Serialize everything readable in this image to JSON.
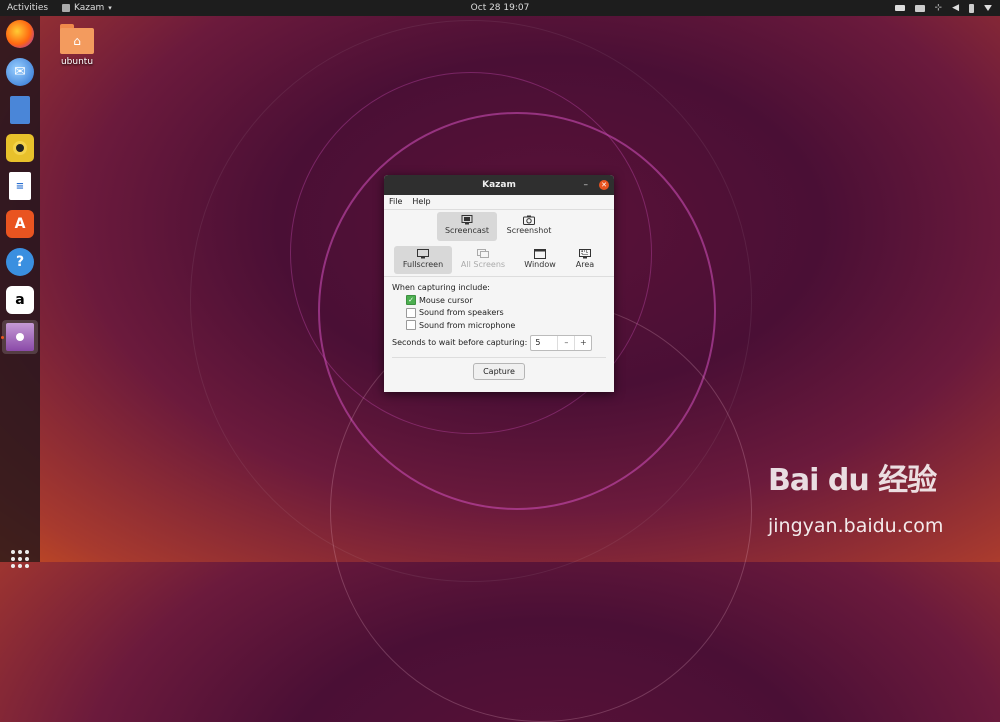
{
  "topbar": {
    "activities": "Activities",
    "app_name": "Kazam",
    "clock": "Oct 28  19:07"
  },
  "dock": {
    "items": [
      "firefox-icon",
      "thunderbird-icon",
      "files-icon",
      "rhythmbox-icon",
      "libreoffice-writer-icon",
      "software-icon",
      "help-icon",
      "amazon-icon",
      "kazam-icon"
    ]
  },
  "desktop": {
    "folder_label": "ubuntu"
  },
  "window": {
    "title": "Kazam",
    "menu": {
      "file": "File",
      "help": "Help"
    },
    "modes": {
      "screencast": "Screencast",
      "screenshot": "Screenshot"
    },
    "targets": {
      "fullscreen": "Fullscreen",
      "all_screens": "All Screens",
      "window": "Window",
      "area": "Area"
    },
    "options_label": "When capturing include:",
    "options": [
      {
        "label": "Mouse cursor",
        "checked": true
      },
      {
        "label": "Sound from speakers",
        "checked": false
      },
      {
        "label": "Sound from microphone",
        "checked": false
      }
    ],
    "delay_label": "Seconds to wait before capturing:",
    "delay_value": "5",
    "minus": "–",
    "plus": "+",
    "capture_label": "Capture"
  },
  "watermark": {
    "logo": "Bai du 经验",
    "url": "jingyan.baidu.com"
  },
  "colors": {
    "accent": "#e95420",
    "check": "#4caf50"
  }
}
